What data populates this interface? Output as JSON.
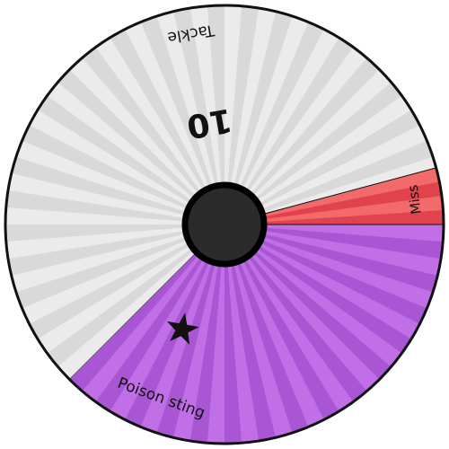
{
  "wheel": {
    "title": "",
    "segments": [
      {
        "name": "Tackle",
        "kind": "normal",
        "power": "10",
        "color_light": "#ebebeb",
        "color_dark": "#d9d9d9",
        "start_deg": -135,
        "end_deg": 75
      },
      {
        "name": "Miss",
        "kind": "miss",
        "power": "",
        "color_light": "#f26a6a",
        "color_dark": "#e0434d",
        "start_deg": 75,
        "end_deg": 90
      },
      {
        "name": "Poison sting",
        "kind": "purple",
        "power": "",
        "icon": "star-icon",
        "color_light": "#c06fe6",
        "color_dark": "#a856d4",
        "start_deg": 90,
        "end_deg": 225
      }
    ],
    "border_color": "#111111",
    "hub_color": "#2b2b2b",
    "hub_ring_color": "#000000"
  }
}
